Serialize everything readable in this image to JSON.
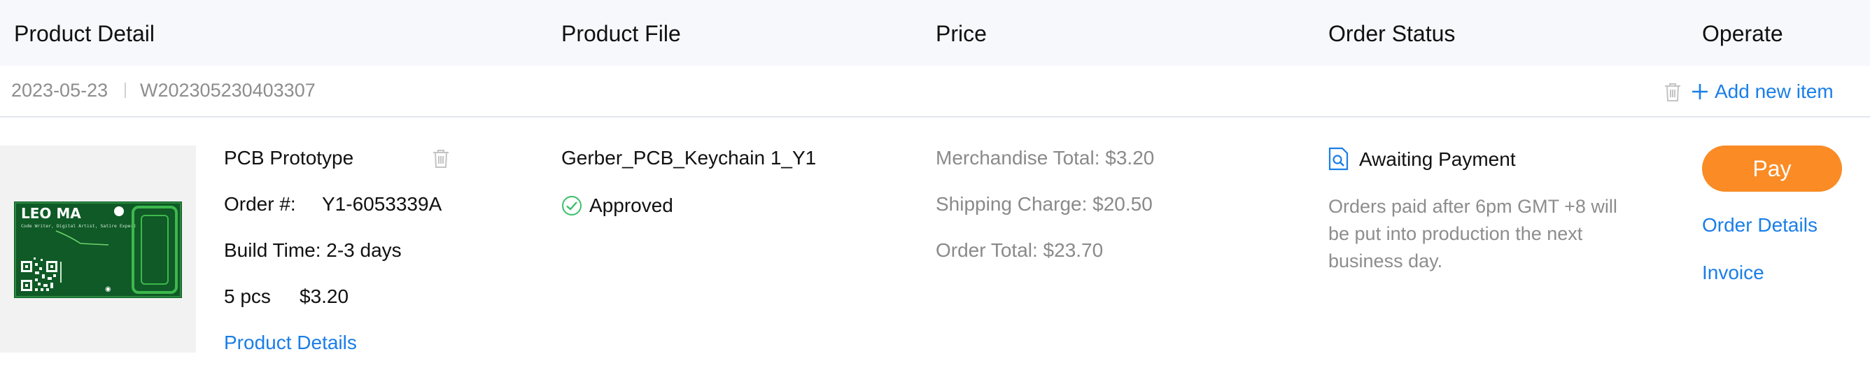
{
  "header": {
    "product_detail": "Product Detail",
    "product_file": "Product File",
    "price": "Price",
    "order_status": "Order Status",
    "operate": "Operate"
  },
  "order": {
    "date": "2023-05-23",
    "number": "W202305230403307",
    "add_item_label": "Add new item"
  },
  "product": {
    "name": "PCB Prototype",
    "order_no_label": "Order #:",
    "order_no": "Y1-6053339A",
    "build_time": "Build Time: 2-3 days",
    "qty": "5 pcs",
    "unit_price": "$3.20",
    "details_link": "Product Details",
    "board_logo": "LEO MA",
    "board_tagline": "Code Writer, Digital Artist, Satire Expert"
  },
  "file": {
    "name": "Gerber_PCB_Keychain 1_Y1",
    "status": "Approved"
  },
  "price": {
    "merchandise": "Merchandise Total: $3.20",
    "shipping": "Shipping Charge: $20.50",
    "total": "Order Total: $23.70"
  },
  "status": {
    "label": "Awaiting Payment",
    "note": "Orders paid after 6pm GMT +8 will be put into production the next business day."
  },
  "operate": {
    "pay": "Pay",
    "order_details": "Order Details",
    "invoice": "Invoice"
  },
  "colors": {
    "accent_blue": "#1a7ee8",
    "pay_orange": "#fb8b24",
    "approved_green": "#3cbf6b",
    "pcb_green": "#0f5a26"
  }
}
